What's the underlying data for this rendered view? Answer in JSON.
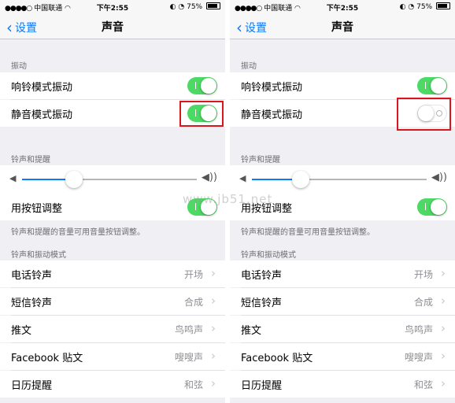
{
  "colors": {
    "accent": "#0a7aff",
    "switch_on": "#4cd964",
    "highlight_box": "#d9161d"
  },
  "icons": [
    "wifi-icon",
    "lock-rotation-icon",
    "alarm-icon",
    "battery-icon",
    "back-chevron-icon",
    "volume-low-icon",
    "volume-high-icon",
    "chevron-right-icon"
  ],
  "watermark": "www.jb51.net",
  "panels": [
    {
      "status": {
        "carrier": "中国联通",
        "time": "下午2:55",
        "battery": "75%"
      },
      "nav": {
        "back_label": "设置",
        "title": "声音"
      },
      "vibrate_header": "振动",
      "ring_vibrate": {
        "label": "响铃模式振动",
        "on": true
      },
      "silent_vibrate": {
        "label": "静音模式振动",
        "on": true
      },
      "ringer_header": "铃声和提醒",
      "volume_level": 0.3,
      "change_with_buttons": {
        "label": "用按钮调整",
        "on": true
      },
      "ringer_footer": "铃声和提醒的音量可用音量按钮调整。",
      "patterns_header": "铃声和振动模式",
      "rows": [
        {
          "label": "电话铃声",
          "value": "开场"
        },
        {
          "label": "短信铃声",
          "value": "合成"
        },
        {
          "label": "推文",
          "value": "鸟鸣声"
        },
        {
          "label": "Facebook 贴文",
          "value": "嗖嗖声"
        },
        {
          "label": "日历提醒",
          "value": "和弦"
        }
      ]
    },
    {
      "status": {
        "carrier": "中国联通",
        "time": "下午2:55",
        "battery": "75%"
      },
      "nav": {
        "back_label": "设置",
        "title": "声音"
      },
      "vibrate_header": "振动",
      "ring_vibrate": {
        "label": "响铃模式振动",
        "on": true
      },
      "silent_vibrate": {
        "label": "静音模式振动",
        "on": false
      },
      "ringer_header": "铃声和提醒",
      "volume_level": 0.3,
      "change_with_buttons": {
        "label": "用按钮调整",
        "on": true
      },
      "ringer_footer": "铃声和提醒的音量可用音量按钮调整。",
      "patterns_header": "铃声和振动模式",
      "rows": [
        {
          "label": "电话铃声",
          "value": "开场"
        },
        {
          "label": "短信铃声",
          "value": "合成"
        },
        {
          "label": "推文",
          "value": "鸟鸣声"
        },
        {
          "label": "Facebook 贴文",
          "value": "嗖嗖声"
        },
        {
          "label": "日历提醒",
          "value": "和弦"
        }
      ]
    }
  ]
}
